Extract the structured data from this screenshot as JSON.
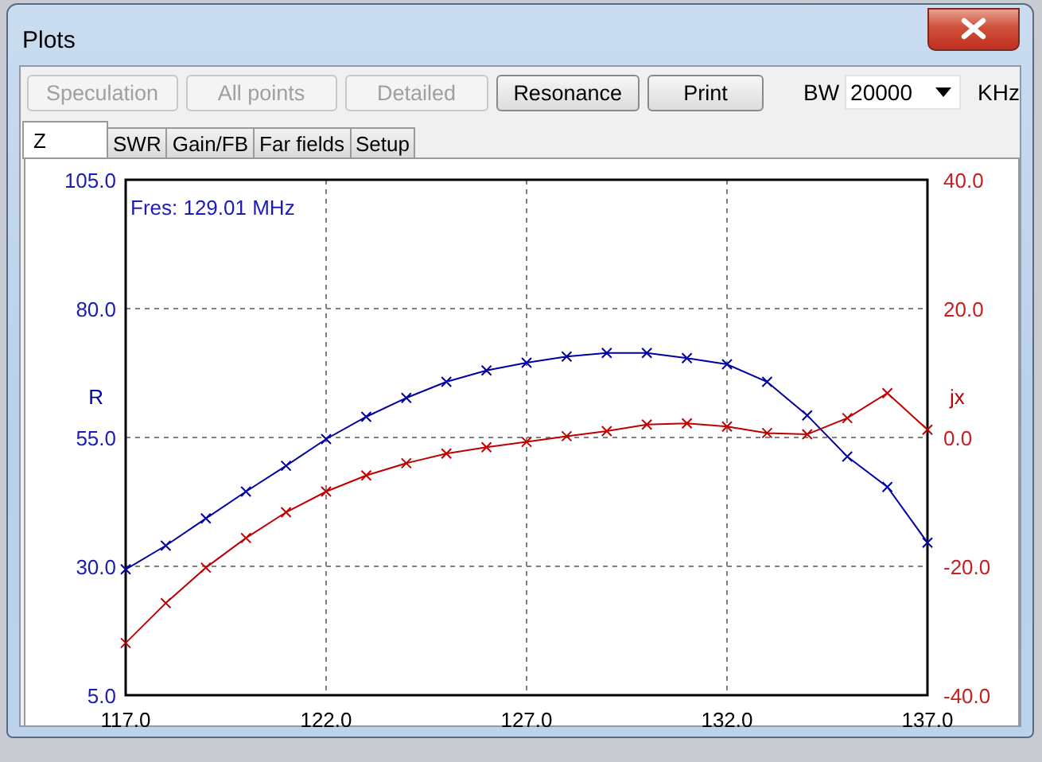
{
  "window": {
    "title": "Plots"
  },
  "toolbar": {
    "buttons": [
      {
        "label": "Speculation",
        "disabled": true
      },
      {
        "label": "All points",
        "disabled": true
      },
      {
        "label": "Detailed",
        "disabled": true
      },
      {
        "label": "Resonance",
        "disabled": false
      },
      {
        "label": "Print",
        "disabled": false
      }
    ],
    "bandwidth": {
      "label": "BW",
      "value": "20000",
      "unit": "KHz"
    }
  },
  "tabs": [
    {
      "label": "Z",
      "selected": true
    },
    {
      "label": "SWR",
      "selected": false
    },
    {
      "label": "Gain/FB",
      "selected": false
    },
    {
      "label": "Far fields",
      "selected": false
    },
    {
      "label": "Setup",
      "selected": false
    }
  ],
  "plot": {
    "annotation": "Fres: 129.01 MHz",
    "chart_data": {
      "type": "line",
      "grid": true,
      "x": [
        117,
        118,
        119,
        120,
        121,
        122,
        123,
        124,
        125,
        126,
        127,
        128,
        129,
        130,
        131,
        132,
        133,
        134,
        135,
        136,
        137
      ],
      "xlim": [
        117,
        137
      ],
      "ylim": [
        5,
        105
      ],
      "y2lim": [
        -40,
        40
      ],
      "xticks": [
        {
          "value": 117,
          "label": "117.0"
        },
        {
          "value": 122,
          "label": "122.0"
        },
        {
          "value": 127,
          "label": "127.0"
        },
        {
          "value": 132,
          "label": "132.0"
        },
        {
          "value": 137,
          "label": "137.0"
        }
      ],
      "yticks": [
        {
          "value": 105,
          "label": "105.0"
        },
        {
          "value": 80,
          "label": "80.0"
        },
        {
          "value": 55,
          "label": "55.0"
        },
        {
          "value": 30,
          "label": "30.0"
        },
        {
          "value": 5,
          "label": "5.0"
        }
      ],
      "y2ticks": [
        {
          "value": 40,
          "label": "40.0"
        },
        {
          "value": 20,
          "label": "20.0"
        },
        {
          "value": 0,
          "label": "0.0"
        },
        {
          "value": -20,
          "label": "-20.0"
        },
        {
          "value": -40,
          "label": "-40.0"
        }
      ],
      "series": [
        {
          "name": "R",
          "color": "#0000a0",
          "marker": "x",
          "values": [
            29.4,
            34.0,
            39.3,
            44.5,
            49.5,
            54.7,
            59.0,
            62.7,
            65.8,
            68.0,
            69.5,
            70.7,
            71.4,
            71.4,
            70.4,
            69.2,
            65.8,
            59.3,
            51.3,
            45.4,
            34.6
          ]
        },
        {
          "name": "jx",
          "color": "#c00000",
          "axis": "y2",
          "marker": "x",
          "values": [
            -31.9,
            -25.7,
            -20.2,
            -15.6,
            -11.6,
            -8.4,
            -5.9,
            -4.0,
            -2.5,
            -1.5,
            -0.7,
            0.2,
            1.0,
            2.0,
            2.2,
            1.7,
            0.7,
            0.5,
            3.0,
            6.9,
            1.2
          ]
        }
      ]
    }
  }
}
